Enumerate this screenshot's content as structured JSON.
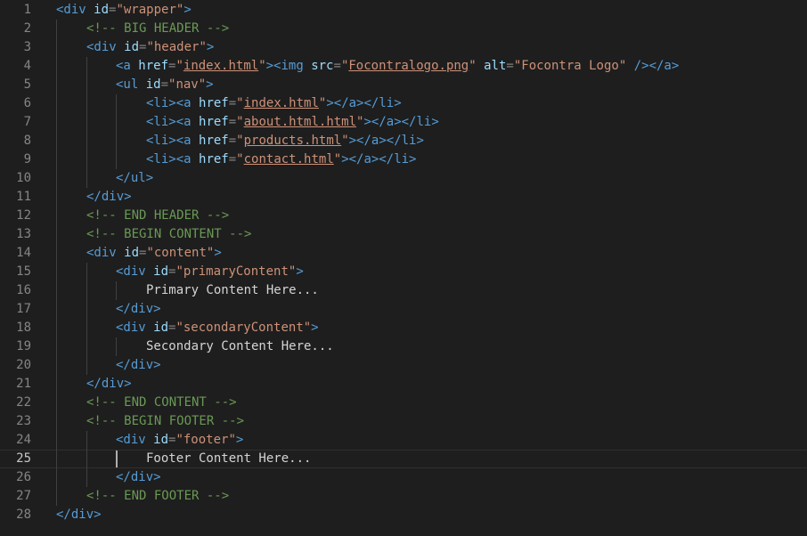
{
  "editor": {
    "current_line": 25,
    "colors": {
      "background": "#1e1e1e",
      "tag": "#569cd6",
      "attribute": "#9cdcfe",
      "string": "#ce9178",
      "comment": "#6a9955",
      "text": "#d4d4d4",
      "line_number": "#858585"
    },
    "lines": [
      {
        "n": "1",
        "indent": 0,
        "tokens": [
          [
            "tag",
            "<div "
          ],
          [
            "attr",
            "id"
          ],
          [
            "pun",
            "="
          ],
          [
            "str",
            "\"wrapper\""
          ],
          [
            "tag",
            ">"
          ]
        ]
      },
      {
        "n": "2",
        "indent": 1,
        "tokens": [
          [
            "cmt",
            "<!-- BIG HEADER -->"
          ]
        ]
      },
      {
        "n": "3",
        "indent": 1,
        "tokens": [
          [
            "tag",
            "<div "
          ],
          [
            "attr",
            "id"
          ],
          [
            "pun",
            "="
          ],
          [
            "str",
            "\"header\""
          ],
          [
            "tag",
            ">"
          ]
        ]
      },
      {
        "n": "4",
        "indent": 2,
        "tokens": [
          [
            "tag",
            "<a "
          ],
          [
            "attr",
            "href"
          ],
          [
            "pun",
            "="
          ],
          [
            "str",
            "\""
          ],
          [
            "strul",
            "index.html"
          ],
          [
            "str",
            "\""
          ],
          [
            "tag",
            "><img "
          ],
          [
            "attr",
            "src"
          ],
          [
            "pun",
            "="
          ],
          [
            "str",
            "\""
          ],
          [
            "strul",
            "Focontralogo.png"
          ],
          [
            "str",
            "\""
          ],
          [
            "txt",
            " "
          ],
          [
            "attr",
            "alt"
          ],
          [
            "pun",
            "="
          ],
          [
            "str",
            "\"Focontra Logo\""
          ],
          [
            "txt",
            " "
          ],
          [
            "tag",
            "/></a>"
          ]
        ]
      },
      {
        "n": "5",
        "indent": 2,
        "tokens": [
          [
            "tag",
            "<ul "
          ],
          [
            "attr",
            "id"
          ],
          [
            "pun",
            "="
          ],
          [
            "str",
            "\"nav\""
          ],
          [
            "tag",
            ">"
          ]
        ]
      },
      {
        "n": "6",
        "indent": 3,
        "tokens": [
          [
            "tag",
            "<li><a "
          ],
          [
            "attr",
            "href"
          ],
          [
            "pun",
            "="
          ],
          [
            "str",
            "\""
          ],
          [
            "strul",
            "index.html"
          ],
          [
            "str",
            "\""
          ],
          [
            "tag",
            "></a></li>"
          ]
        ]
      },
      {
        "n": "7",
        "indent": 3,
        "tokens": [
          [
            "tag",
            "<li><a "
          ],
          [
            "attr",
            "href"
          ],
          [
            "pun",
            "="
          ],
          [
            "str",
            "\""
          ],
          [
            "strul",
            "about.html.html"
          ],
          [
            "str",
            "\""
          ],
          [
            "tag",
            "></a></li>"
          ]
        ]
      },
      {
        "n": "8",
        "indent": 3,
        "tokens": [
          [
            "tag",
            "<li><a "
          ],
          [
            "attr",
            "href"
          ],
          [
            "pun",
            "="
          ],
          [
            "str",
            "\""
          ],
          [
            "strul",
            "products.html"
          ],
          [
            "str",
            "\""
          ],
          [
            "tag",
            "></a></li>"
          ]
        ]
      },
      {
        "n": "9",
        "indent": 3,
        "tokens": [
          [
            "tag",
            "<li><a "
          ],
          [
            "attr",
            "href"
          ],
          [
            "pun",
            "="
          ],
          [
            "str",
            "\""
          ],
          [
            "strul",
            "contact.html"
          ],
          [
            "str",
            "\""
          ],
          [
            "tag",
            "></a></li>"
          ]
        ]
      },
      {
        "n": "10",
        "indent": 2,
        "tokens": [
          [
            "tag",
            "</ul>"
          ]
        ]
      },
      {
        "n": "11",
        "indent": 1,
        "tokens": [
          [
            "tag",
            "</div>"
          ]
        ]
      },
      {
        "n": "12",
        "indent": 1,
        "tokens": [
          [
            "cmt",
            "<!-- END HEADER -->"
          ]
        ]
      },
      {
        "n": "13",
        "indent": 1,
        "tokens": [
          [
            "cmt",
            "<!-- BEGIN CONTENT -->"
          ]
        ]
      },
      {
        "n": "14",
        "indent": 1,
        "tokens": [
          [
            "tag",
            "<div "
          ],
          [
            "attr",
            "id"
          ],
          [
            "pun",
            "="
          ],
          [
            "str",
            "\"content\""
          ],
          [
            "tag",
            ">"
          ]
        ]
      },
      {
        "n": "15",
        "indent": 2,
        "tokens": [
          [
            "tag",
            "<div "
          ],
          [
            "attr",
            "id"
          ],
          [
            "pun",
            "="
          ],
          [
            "str",
            "\"primaryContent\""
          ],
          [
            "tag",
            ">"
          ]
        ]
      },
      {
        "n": "16",
        "indent": 3,
        "tokens": [
          [
            "txt",
            "Primary Content Here..."
          ]
        ]
      },
      {
        "n": "17",
        "indent": 2,
        "tokens": [
          [
            "tag",
            "</div>"
          ]
        ]
      },
      {
        "n": "18",
        "indent": 2,
        "tokens": [
          [
            "tag",
            "<div "
          ],
          [
            "attr",
            "id"
          ],
          [
            "pun",
            "="
          ],
          [
            "str",
            "\"secondaryContent\""
          ],
          [
            "tag",
            ">"
          ]
        ]
      },
      {
        "n": "19",
        "indent": 3,
        "tokens": [
          [
            "txt",
            "Secondary Content Here..."
          ]
        ]
      },
      {
        "n": "20",
        "indent": 2,
        "tokens": [
          [
            "tag",
            "</div>"
          ]
        ]
      },
      {
        "n": "21",
        "indent": 1,
        "tokens": [
          [
            "tag",
            "</div>"
          ]
        ]
      },
      {
        "n": "22",
        "indent": 1,
        "tokens": [
          [
            "cmt",
            "<!-- END CONTENT -->"
          ]
        ]
      },
      {
        "n": "23",
        "indent": 1,
        "tokens": [
          [
            "cmt",
            "<!-- BEGIN FOOTER -->"
          ]
        ]
      },
      {
        "n": "24",
        "indent": 2,
        "tokens": [
          [
            "tag",
            "<div "
          ],
          [
            "attr",
            "id"
          ],
          [
            "pun",
            "="
          ],
          [
            "str",
            "\"footer\""
          ],
          [
            "tag",
            ">"
          ]
        ]
      },
      {
        "n": "25",
        "indent": 3,
        "tokens": [
          [
            "txt",
            "Footer Content Here..."
          ]
        ]
      },
      {
        "n": "26",
        "indent": 2,
        "tokens": [
          [
            "tag",
            "</div>"
          ]
        ]
      },
      {
        "n": "27",
        "indent": 1,
        "tokens": [
          [
            "cmt",
            "<!-- END FOOTER -->"
          ]
        ]
      },
      {
        "n": "28",
        "indent": 0,
        "tokens": [
          [
            "tag",
            "</div>"
          ]
        ]
      }
    ]
  }
}
